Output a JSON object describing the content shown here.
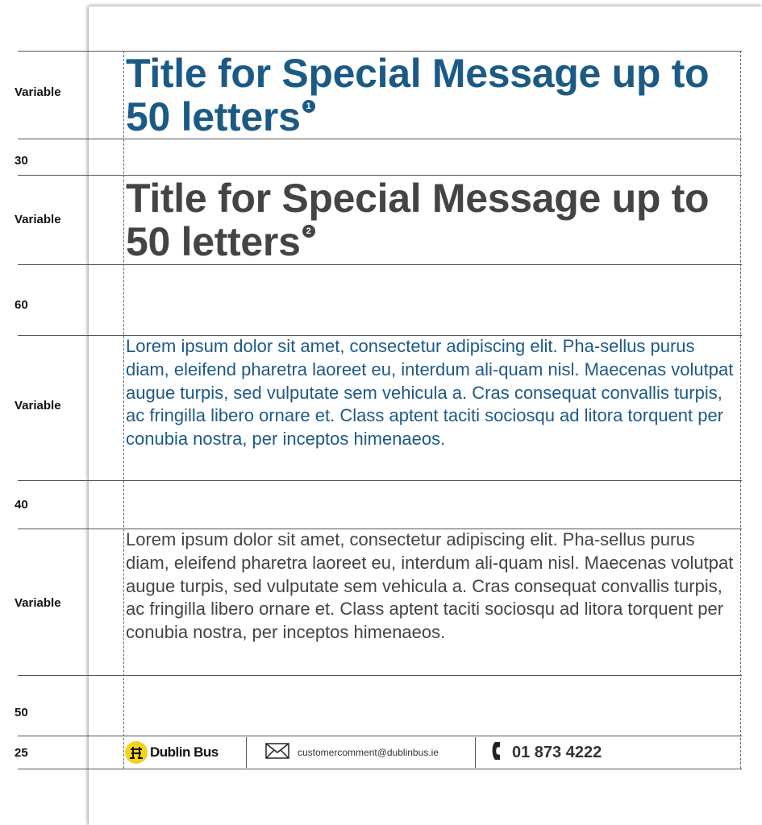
{
  "labels": {
    "title1": "Variable",
    "gap1": "30",
    "title2": "Variable",
    "gap2": "60",
    "body1": "Variable",
    "gap3": "40",
    "body2": "Variable",
    "gap4": "50",
    "footer": "25"
  },
  "titles": {
    "primary": "Title for Special Message up to 50 letters",
    "secondary": "Title for Special Message up to 50 letters",
    "marker1": "1",
    "marker2": "2"
  },
  "body": {
    "primary": "Lorem ipsum dolor sit amet, consectetur adipiscing elit. Pha-sellus purus diam, eleifend pharetra laoreet eu, interdum ali-quam nisl. Maecenas volutpat augue turpis, sed vulputate sem vehicula a. Cras consequat convallis turpis, ac fringilla libero ornare et. Class aptent taciti sociosqu ad litora torquent per conubia nostra, per inceptos himenaeos.",
    "secondary": "Lorem ipsum dolor sit amet, consectetur adipiscing elit. Pha-sellus purus diam, eleifend pharetra laoreet eu, interdum ali-quam nisl. Maecenas volutpat augue turpis, sed vulputate sem vehicula a. Cras consequat convallis turpis, ac fringilla libero ornare et. Class aptent taciti sociosqu ad litora torquent per conubia nostra, per inceptos himenaeos."
  },
  "footer": {
    "brand": "Dublin Bus",
    "email": "customercomment@dublinbus.ie",
    "phone": "01 873 4222",
    "icons": [
      "dublin-bus-logo-icon",
      "envelope-icon",
      "phone-icon"
    ]
  },
  "colors": {
    "primary_text": "#1c5a86",
    "secondary_text": "#444444",
    "brand_yellow": "#f5d21e"
  }
}
